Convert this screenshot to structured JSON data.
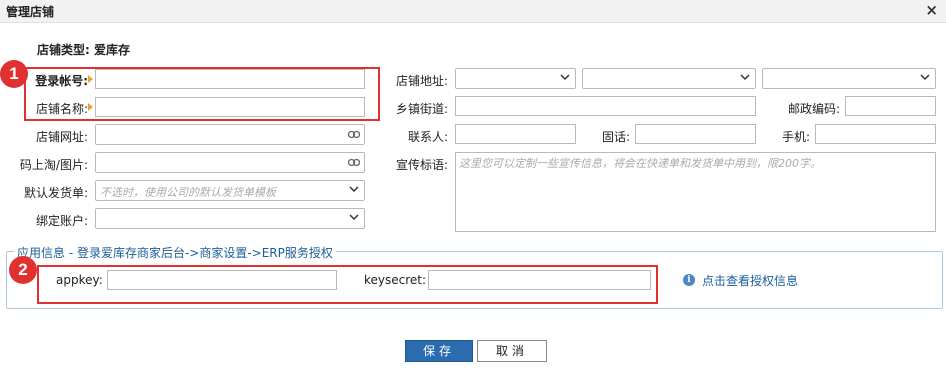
{
  "dialog": {
    "title": "管理店铺",
    "close_symbol": "×"
  },
  "store_type": {
    "label": "店铺类型:",
    "value": "爱库存"
  },
  "fields_left": {
    "login_account": {
      "label": "登录帐号:",
      "value": ""
    },
    "store_name": {
      "label": "店铺名称:",
      "value": ""
    },
    "store_url": {
      "label": "店铺网址:",
      "value": ""
    },
    "qr_image": {
      "label": "码上淘/图片:",
      "value": ""
    },
    "default_invoice": {
      "label": "默认发货单:",
      "placeholder": "不选时，使用公司的默认发货单模板"
    },
    "bind_account": {
      "label": "绑定账户:",
      "value": ""
    }
  },
  "fields_right": {
    "store_address": {
      "label": "店铺地址:"
    },
    "street": {
      "label": "乡镇街道:",
      "value": ""
    },
    "postcode": {
      "label": "邮政编码:",
      "value": ""
    },
    "contact": {
      "label": "联系人:",
      "value": ""
    },
    "phone": {
      "label": "固话:",
      "value": ""
    },
    "mobile": {
      "label": "手机:",
      "value": ""
    },
    "slogan": {
      "label": "宣传标语:",
      "placeholder": "这里您可以定制一些宣传信息，将会在快递单和发货单中用到，限200字。"
    }
  },
  "app_info": {
    "legend": "应用信息 - 登录爱库存商家后台->商家设置->ERP服务授权",
    "appkey": {
      "label": "appkey:",
      "value": ""
    },
    "keysecret": {
      "label": "keysecret:",
      "value": ""
    },
    "view_link": "点击查看授权信息"
  },
  "annotations": {
    "badge1": "1",
    "badge2": "2",
    "highlight_color": "#e03030"
  },
  "buttons": {
    "save": "保存",
    "cancel": "取消"
  },
  "colors": {
    "primary": "#2b6cb0",
    "required_marker": "#f0a030",
    "legend_text": "#1a5d9a"
  }
}
